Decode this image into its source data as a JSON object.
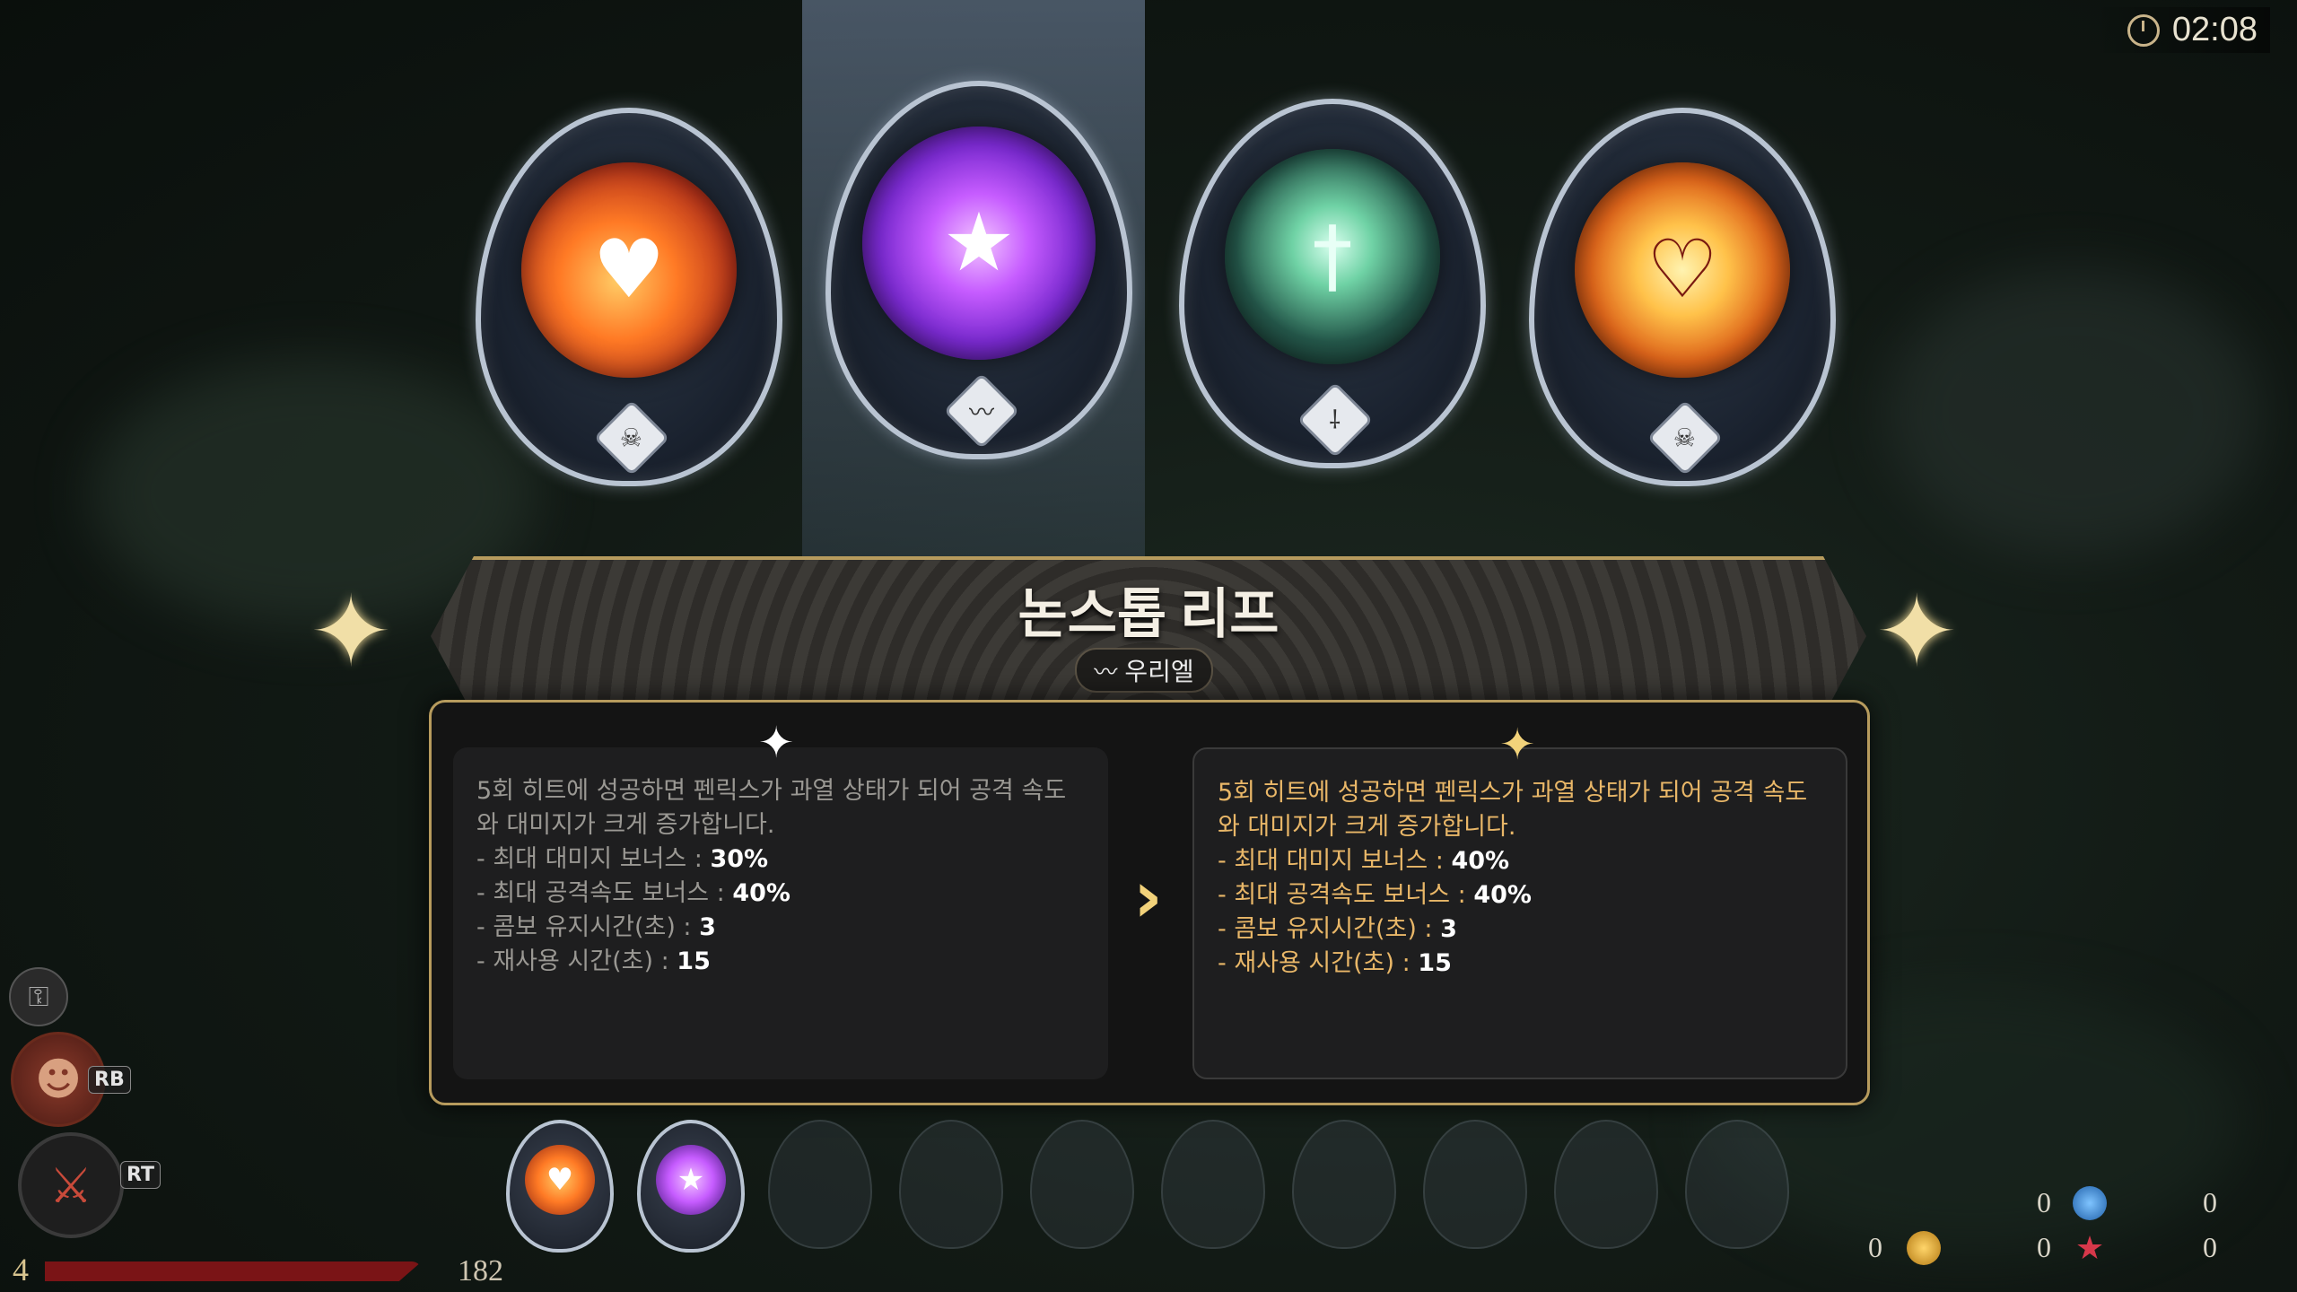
{
  "timer": {
    "value": "02:08",
    "icon": "clock-icon"
  },
  "orbs": [
    {
      "name": "fire-heart-orb",
      "glyph": "♥",
      "badge_icon": "flame-skull-icon",
      "badge_glyph": "☠",
      "colors": [
        "#ff9b3a",
        "#b8331a"
      ]
    },
    {
      "name": "star-burst-orb",
      "glyph": "★",
      "badge_icon": "pulse-icon",
      "badge_glyph": "〰",
      "colors": [
        "#c65cff",
        "#4a1a8a"
      ],
      "selected": true
    },
    {
      "name": "sword-orb",
      "glyph": "†",
      "badge_icon": "sword-icon",
      "badge_glyph": "⸸",
      "colors": [
        "#6fd2a5",
        "#1b3a35"
      ]
    },
    {
      "name": "flame-heart-orb",
      "glyph": "♡",
      "badge_icon": "flame-skull-icon",
      "badge_glyph": "☠",
      "colors": [
        "#ffc24a",
        "#a83a10"
      ]
    }
  ],
  "title": "논스톱 리프",
  "subtitle": {
    "icon": "pulse-icon",
    "label": "우리엘"
  },
  "current": {
    "lines": [
      {
        "text": "5회 히트에 성공하면 펜릭스가 과열 상태가 되어 공격 속도",
        "value": ""
      },
      {
        "text": "와 대미지가 크게 증가합니다.",
        "value": ""
      },
      {
        "text": "- 최대 대미지 보너스 : ",
        "value": "30%"
      },
      {
        "text": "- 최대 공격속도 보너스 : ",
        "value": "40%"
      },
      {
        "text": "- 콤보 유지시간(초) : ",
        "value": "3"
      },
      {
        "text": "- 재사용 시간(초) : ",
        "value": "15"
      }
    ]
  },
  "upgraded": {
    "lines": [
      {
        "text": "5회 히트에 성공하면 펜릭스가 과열 상태가 되어 공격 속도",
        "value": ""
      },
      {
        "text": "와 대미지가 크게 증가합니다.",
        "value": ""
      },
      {
        "text": "- 최대 대미지 보너스 : ",
        "value": "40%"
      },
      {
        "text": "- 최대 공격속도 보너스 : ",
        "value": "40%"
      },
      {
        "text": "- 콤보 유지시간(초) : ",
        "value": "3"
      },
      {
        "text": "- 재사용 시간(초) : ",
        "value": "15"
      }
    ]
  },
  "hud": {
    "level": "4",
    "hp": "182",
    "rb_label": "RB",
    "rt_label": "RT",
    "counters": [
      "0",
      "0",
      "0",
      "0",
      "0"
    ]
  },
  "colors": {
    "accent_gold": "#b79b5d",
    "upgrade_text": "#e9b768"
  }
}
